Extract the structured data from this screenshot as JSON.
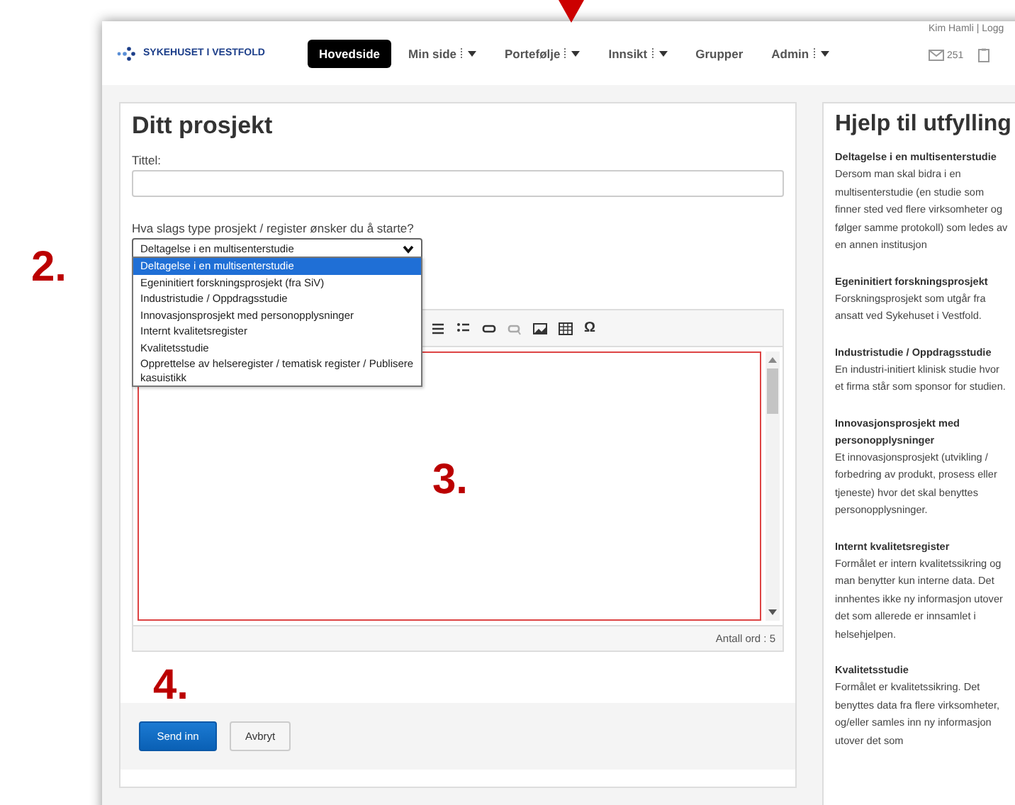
{
  "annotations": [
    {
      "label": "2.",
      "kind": "number"
    },
    {
      "label": "3.",
      "kind": "number"
    },
    {
      "label": "4.",
      "kind": "number"
    }
  ],
  "header": {
    "logo": "SYKEHUSET I VESTFOLD",
    "user": "Kim Hamli | Logg",
    "mail_count": "251",
    "nav": [
      {
        "label": "Hovedside",
        "selected": true,
        "menu": false
      },
      {
        "label": "Min side",
        "selected": false,
        "menu": true
      },
      {
        "label": "Portefølje",
        "selected": false,
        "menu": true
      },
      {
        "label": "Innsikt",
        "selected": false,
        "menu": true
      },
      {
        "label": "Grupper",
        "selected": false,
        "menu": false
      },
      {
        "label": "Admin",
        "selected": false,
        "menu": true
      }
    ]
  },
  "form": {
    "title": "Ditt prosjekt",
    "title_label": "Tittel:",
    "type_label": "Hva slags type prosjekt / register ønsker du å starte?",
    "type_value": "Deltagelse i en multisenterstudie",
    "options": [
      {
        "label": "Deltagelse i en multisenterstudie",
        "selected": true
      },
      {
        "label": "Egeninitiert forskningsprosjekt (fra SiV)",
        "selected": false
      },
      {
        "label": "Industristudie / Oppdragsstudie",
        "selected": false
      },
      {
        "label": "Innovasjonsprosjekt med personopplysninger",
        "selected": false
      },
      {
        "label": "Internt kvalitetsregister",
        "selected": false
      },
      {
        "label": "Kvalitetsstudie",
        "selected": false
      },
      {
        "label": "Opprettelse av helseregister / tematisk register / Publisere kasuistikk",
        "selected": false
      }
    ],
    "toolbar_symbol": "Ω",
    "word_count": "Antall ord : 5",
    "buttons": [
      {
        "label": "Send inn",
        "kind": "primary"
      },
      {
        "label": "Avbryt",
        "kind": "default"
      }
    ]
  },
  "help": {
    "title": "Hjelp til utfylling",
    "sections": [
      {
        "heading": "Deltagelse i en multisenterstudie",
        "body": "Dersom man skal bidra i en multisenterstudie (en studie som finner sted ved flere virksomheter og følger samme protokoll) som ledes av en annen institusjon"
      },
      {
        "heading": "Egeninitiert forskningsprosjekt",
        "body": "Forskningsprosjekt som utgår fra ansatt ved Sykehuset i Vestfold."
      },
      {
        "heading": "Industristudie / Oppdragsstudie",
        "body": "En industri-initiert klinisk studie hvor et firma står som sponsor for studien."
      },
      {
        "heading": "Innovasjonsprosjekt med personopplysninger",
        "body": "Et innovasjonsprosjekt (utvikling / forbedring av produkt, prosess eller tjeneste) hvor det skal benyttes personopplysninger."
      },
      {
        "heading": "Internt kvalitetsregister",
        "body": "Formålet er intern kvalitetssikring og man benytter kun interne data. Det innhentes ikke ny informasjon utover det som allerede er innsamlet i helsehjelpen."
      },
      {
        "heading": "Kvalitetsstudie",
        "body": "Formålet er kvalitetssikring. Det benyttes data fra flere virksomheter, og/eller samles inn ny informasjon utover det som"
      }
    ]
  }
}
